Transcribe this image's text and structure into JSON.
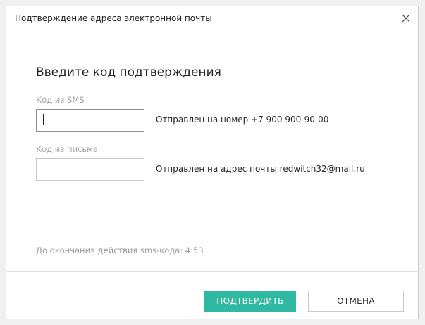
{
  "dialog": {
    "title": "Подтверждение адреса электронной почты",
    "close_icon": "close-icon",
    "heading": "Введите код подтверждения"
  },
  "sms": {
    "label": "Код из SMS",
    "value": "",
    "hint": "Отправлен на номер +7  900 900-90-00"
  },
  "email": {
    "label": "Код из письма",
    "value": "",
    "hint": "Отправлен на адрес почты redwitch32@mail.ru"
  },
  "timer_text": "До окончания действия sms-кода: 4:53",
  "buttons": {
    "confirm": "ПОДТВЕРДИТЬ",
    "cancel": "ОТМЕНА"
  },
  "colors": {
    "accent": "#2fb9a2"
  }
}
